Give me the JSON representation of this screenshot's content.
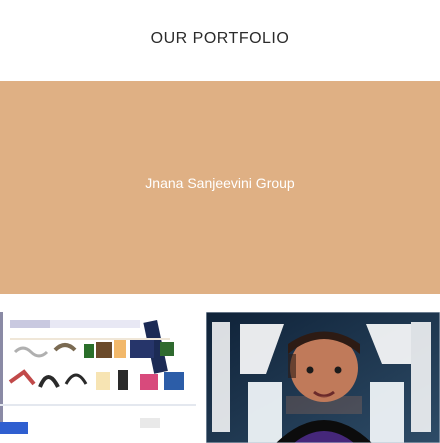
{
  "portfolio": {
    "heading": "OUR PORTFOLIO",
    "featured_title": "Jnana Sanjeevini Group",
    "colors": {
      "hero_background": "#dfb084",
      "hero_text": "#ffffff",
      "heading_text": "#2b2b2b"
    }
  }
}
